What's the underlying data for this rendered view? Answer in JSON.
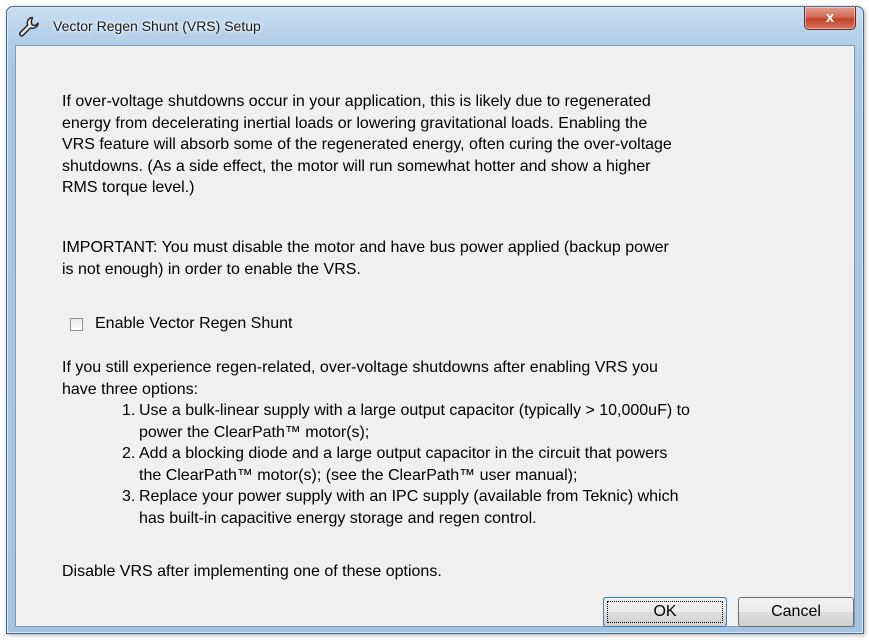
{
  "window": {
    "title": "Vector Regen Shunt (VRS) Setup",
    "icon": "wrench-icon",
    "close_glyph": "x"
  },
  "content": {
    "paragraph1_lines": [
      "If over-voltage shutdowns occur in your application, this is likely due to regenerated",
      "energy from decelerating inertial loads or lowering gravitational loads.  Enabling the",
      "VRS feature will absorb some of the regenerated energy, often curing the over-voltage",
      "shutdowns.  (As a side effect, the motor will run somewhat hotter and show a higher",
      "RMS torque level.)"
    ],
    "paragraph2_lines": [
      "IMPORTANT: You must disable the motor and have bus power applied (backup power",
      "is not enough) in order to enable the VRS."
    ],
    "checkbox": {
      "label": "Enable Vector Regen Shunt",
      "checked": false
    },
    "paragraph3_lines": [
      "If you still experience regen-related, over-voltage shutdowns after enabling VRS you",
      "have three options:"
    ],
    "options": [
      {
        "number": "1.",
        "lines": [
          "Use a bulk-linear supply with a large output capacitor (typically > 10,000uF) to",
          "power the ClearPath™ motor(s);"
        ]
      },
      {
        "number": "2.",
        "lines": [
          "Add a blocking diode and a large output capacitor in the circuit that powers",
          "the ClearPath™ motor(s); (see the ClearPath™ user manual);"
        ]
      },
      {
        "number": "3.",
        "lines": [
          "Replace your power supply with an IPC supply (available from Teknic) which",
          "has built-in capacitive energy storage and regen control."
        ]
      }
    ],
    "closing": "Disable VRS after implementing one of these options."
  },
  "buttons": {
    "ok_label": "OK",
    "cancel_label": "Cancel"
  }
}
